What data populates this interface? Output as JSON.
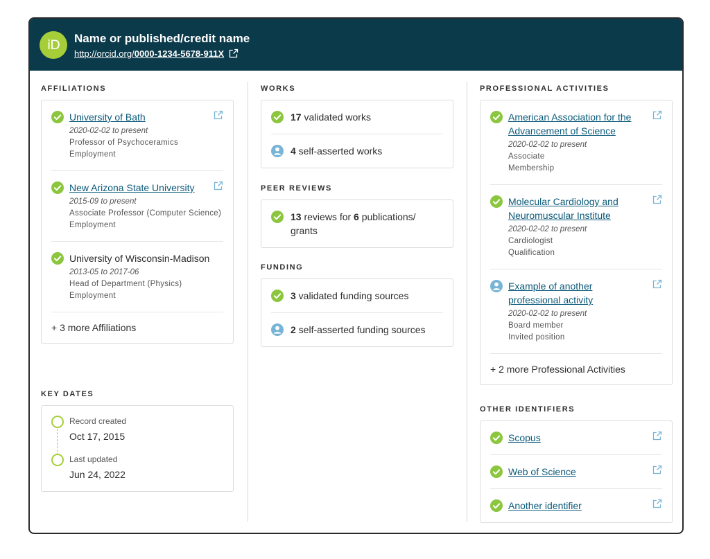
{
  "header": {
    "name": "Name or published/credit name",
    "url_prefix": "http://orcid.org/",
    "orcid_id": "0000-1234-5678-911X",
    "logo_text": "iD"
  },
  "colors": {
    "header_bg": "#0b3a4b",
    "orcid_green": "#a6ce39",
    "validated": "#8cc63f",
    "self_asserted": "#78b4d6",
    "link": "#0b5a7a"
  },
  "affiliations": {
    "title": "AFFILIATIONS",
    "items": [
      {
        "name": "University of Bath",
        "date": "2020-02-02 to present",
        "role": "Professor of Psychoceramics",
        "type": "Employment",
        "status": "validated"
      },
      {
        "name": "New Arizona State University",
        "date": "2015-09 to present",
        "role": "Associate Professor (Computer Science)",
        "type": "Employment",
        "status": "validated"
      },
      {
        "name": "University of Wisconsin-Madison",
        "date": "2013-05 to 2017-06",
        "role": "Head of Department (Physics)",
        "type": "Employment",
        "status": "validated"
      }
    ],
    "more": "+ 3 more Affiliations"
  },
  "key_dates": {
    "title": "KEY DATES",
    "created_label": "Record created",
    "created_value": "Oct 17, 2015",
    "updated_label": "Last updated",
    "updated_value": "Jun 24, 2022"
  },
  "works": {
    "title": "WORKS",
    "validated_count": "17",
    "validated_text": " validated works",
    "self_count": "4",
    "self_text": " self-asserted works"
  },
  "peer_reviews": {
    "title": "PEER REVIEWS",
    "reviews_count": "13",
    "reviews_text": " reviews for ",
    "pubs_count": "6",
    "pubs_text": " publications/ grants"
  },
  "funding": {
    "title": "FUNDING",
    "validated_count": "3",
    "validated_text": " validated funding sources",
    "self_count": "2",
    "self_text": " self-asserted funding sources"
  },
  "professional_activities": {
    "title": "PROFESSIONAL ACTIVITIES",
    "items": [
      {
        "name": "American Association for the Advancement of Science",
        "date": "2020-02-02 to present",
        "role": "Associate",
        "type": "Membership",
        "status": "validated"
      },
      {
        "name": "Molecular Cardiology and Neuromuscular Institute",
        "date": "2020-02-02 to present",
        "role": "Cardiologist",
        "type": "Qualification",
        "status": "validated"
      },
      {
        "name": "Example of another professional activity",
        "date": "2020-02-02 to present",
        "role": "Board member",
        "type": "Invited position",
        "status": "self-asserted"
      }
    ],
    "more": "+ 2 more Professional Activities"
  },
  "other_identifiers": {
    "title": "OTHER IDENTIFIERS",
    "items": [
      {
        "name": "Scopus",
        "status": "validated"
      },
      {
        "name": "Web of Science",
        "status": "validated"
      },
      {
        "name": "Another identifier",
        "status": "validated"
      }
    ]
  }
}
